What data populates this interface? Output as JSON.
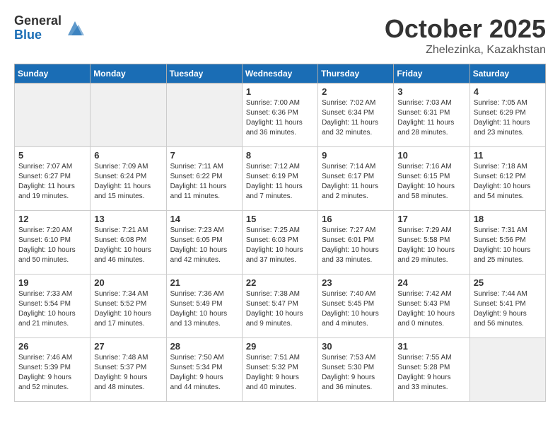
{
  "header": {
    "logo_general": "General",
    "logo_blue": "Blue",
    "month": "October 2025",
    "location": "Zhelezinka, Kazakhstan"
  },
  "weekdays": [
    "Sunday",
    "Monday",
    "Tuesday",
    "Wednesday",
    "Thursday",
    "Friday",
    "Saturday"
  ],
  "weeks": [
    [
      {
        "day": "",
        "info": "",
        "empty": true
      },
      {
        "day": "",
        "info": "",
        "empty": true
      },
      {
        "day": "",
        "info": "",
        "empty": true
      },
      {
        "day": "1",
        "info": "Sunrise: 7:00 AM\nSunset: 6:36 PM\nDaylight: 11 hours\nand 36 minutes.",
        "empty": false
      },
      {
        "day": "2",
        "info": "Sunrise: 7:02 AM\nSunset: 6:34 PM\nDaylight: 11 hours\nand 32 minutes.",
        "empty": false
      },
      {
        "day": "3",
        "info": "Sunrise: 7:03 AM\nSunset: 6:31 PM\nDaylight: 11 hours\nand 28 minutes.",
        "empty": false
      },
      {
        "day": "4",
        "info": "Sunrise: 7:05 AM\nSunset: 6:29 PM\nDaylight: 11 hours\nand 23 minutes.",
        "empty": false
      }
    ],
    [
      {
        "day": "5",
        "info": "Sunrise: 7:07 AM\nSunset: 6:27 PM\nDaylight: 11 hours\nand 19 minutes.",
        "empty": false
      },
      {
        "day": "6",
        "info": "Sunrise: 7:09 AM\nSunset: 6:24 PM\nDaylight: 11 hours\nand 15 minutes.",
        "empty": false
      },
      {
        "day": "7",
        "info": "Sunrise: 7:11 AM\nSunset: 6:22 PM\nDaylight: 11 hours\nand 11 minutes.",
        "empty": false
      },
      {
        "day": "8",
        "info": "Sunrise: 7:12 AM\nSunset: 6:19 PM\nDaylight: 11 hours\nand 7 minutes.",
        "empty": false
      },
      {
        "day": "9",
        "info": "Sunrise: 7:14 AM\nSunset: 6:17 PM\nDaylight: 11 hours\nand 2 minutes.",
        "empty": false
      },
      {
        "day": "10",
        "info": "Sunrise: 7:16 AM\nSunset: 6:15 PM\nDaylight: 10 hours\nand 58 minutes.",
        "empty": false
      },
      {
        "day": "11",
        "info": "Sunrise: 7:18 AM\nSunset: 6:12 PM\nDaylight: 10 hours\nand 54 minutes.",
        "empty": false
      }
    ],
    [
      {
        "day": "12",
        "info": "Sunrise: 7:20 AM\nSunset: 6:10 PM\nDaylight: 10 hours\nand 50 minutes.",
        "empty": false
      },
      {
        "day": "13",
        "info": "Sunrise: 7:21 AM\nSunset: 6:08 PM\nDaylight: 10 hours\nand 46 minutes.",
        "empty": false
      },
      {
        "day": "14",
        "info": "Sunrise: 7:23 AM\nSunset: 6:05 PM\nDaylight: 10 hours\nand 42 minutes.",
        "empty": false
      },
      {
        "day": "15",
        "info": "Sunrise: 7:25 AM\nSunset: 6:03 PM\nDaylight: 10 hours\nand 37 minutes.",
        "empty": false
      },
      {
        "day": "16",
        "info": "Sunrise: 7:27 AM\nSunset: 6:01 PM\nDaylight: 10 hours\nand 33 minutes.",
        "empty": false
      },
      {
        "day": "17",
        "info": "Sunrise: 7:29 AM\nSunset: 5:58 PM\nDaylight: 10 hours\nand 29 minutes.",
        "empty": false
      },
      {
        "day": "18",
        "info": "Sunrise: 7:31 AM\nSunset: 5:56 PM\nDaylight: 10 hours\nand 25 minutes.",
        "empty": false
      }
    ],
    [
      {
        "day": "19",
        "info": "Sunrise: 7:33 AM\nSunset: 5:54 PM\nDaylight: 10 hours\nand 21 minutes.",
        "empty": false
      },
      {
        "day": "20",
        "info": "Sunrise: 7:34 AM\nSunset: 5:52 PM\nDaylight: 10 hours\nand 17 minutes.",
        "empty": false
      },
      {
        "day": "21",
        "info": "Sunrise: 7:36 AM\nSunset: 5:49 PM\nDaylight: 10 hours\nand 13 minutes.",
        "empty": false
      },
      {
        "day": "22",
        "info": "Sunrise: 7:38 AM\nSunset: 5:47 PM\nDaylight: 10 hours\nand 9 minutes.",
        "empty": false
      },
      {
        "day": "23",
        "info": "Sunrise: 7:40 AM\nSunset: 5:45 PM\nDaylight: 10 hours\nand 4 minutes.",
        "empty": false
      },
      {
        "day": "24",
        "info": "Sunrise: 7:42 AM\nSunset: 5:43 PM\nDaylight: 10 hours\nand 0 minutes.",
        "empty": false
      },
      {
        "day": "25",
        "info": "Sunrise: 7:44 AM\nSunset: 5:41 PM\nDaylight: 9 hours\nand 56 minutes.",
        "empty": false
      }
    ],
    [
      {
        "day": "26",
        "info": "Sunrise: 7:46 AM\nSunset: 5:39 PM\nDaylight: 9 hours\nand 52 minutes.",
        "empty": false
      },
      {
        "day": "27",
        "info": "Sunrise: 7:48 AM\nSunset: 5:37 PM\nDaylight: 9 hours\nand 48 minutes.",
        "empty": false
      },
      {
        "day": "28",
        "info": "Sunrise: 7:50 AM\nSunset: 5:34 PM\nDaylight: 9 hours\nand 44 minutes.",
        "empty": false
      },
      {
        "day": "29",
        "info": "Sunrise: 7:51 AM\nSunset: 5:32 PM\nDaylight: 9 hours\nand 40 minutes.",
        "empty": false
      },
      {
        "day": "30",
        "info": "Sunrise: 7:53 AM\nSunset: 5:30 PM\nDaylight: 9 hours\nand 36 minutes.",
        "empty": false
      },
      {
        "day": "31",
        "info": "Sunrise: 7:55 AM\nSunset: 5:28 PM\nDaylight: 9 hours\nand 33 minutes.",
        "empty": false
      },
      {
        "day": "",
        "info": "",
        "empty": true
      }
    ]
  ]
}
